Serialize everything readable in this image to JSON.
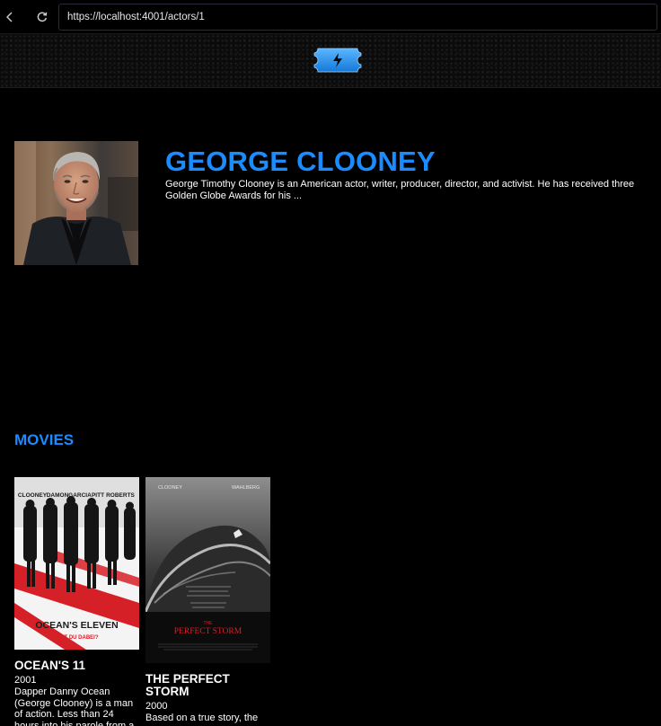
{
  "browser": {
    "url": "https://localhost:4001/actors/1",
    "back_icon": "chevron-left-icon",
    "reload_icon": "reload-icon"
  },
  "header": {
    "logo_icon": "lightning-ticket-icon",
    "logo_color": "#1e8ff0"
  },
  "actor": {
    "name": "GEORGE CLOONEY",
    "bio": "George Timothy Clooney is an American actor, writer, producer, director, and activist. He has received three Golden Globe Awards for his ...",
    "accent_color": "#1a8cff"
  },
  "movies_section": {
    "title": "MOVIES"
  },
  "movies": [
    {
      "title": "OCEAN'S 11",
      "year": "2001",
      "description": "Dapper Danny Ocean (George Clooney) is a man of action. Less than 24 hours into his parole from a New",
      "poster": {
        "cast_names": [
          "CLOONEY",
          "DAMON",
          "GARCIA",
          "PITT",
          "ROBERTS"
        ],
        "title": "OCEAN'S ELEVEN",
        "tagline": "BIST DU DABEI?"
      }
    },
    {
      "title": "THE PERFECT STORM",
      "year": "2000",
      "description": "Based on a true story, the",
      "poster": {
        "cast_left": "CLOONEY",
        "cast_right": "WAHLBERG",
        "title_small": "THE",
        "title": "PERFECT STORM"
      }
    }
  ]
}
